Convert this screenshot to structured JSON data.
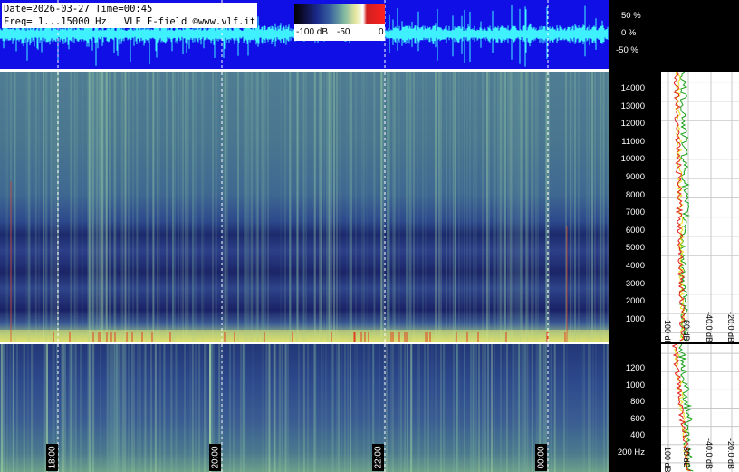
{
  "info": {
    "line1": "Date=2026-03-27 Time=00:45",
    "line2": "Freq= 1...15000 Hz   VLF E-field ©www.vlf.it"
  },
  "colorbar": {
    "labels": [
      "-100 dB",
      "-50",
      "0"
    ],
    "colors": [
      "#000000",
      "#1a2a8a",
      "#3a64a0",
      "#7fb8a0",
      "#e8e8a0",
      "#ffffff",
      "#ff2020"
    ]
  },
  "waveform_axis": [
    "50 %",
    "0 %",
    "-50 %"
  ],
  "freq_axis_high": [
    "14000",
    "13000",
    "12000",
    "11000",
    "10000",
    "9000",
    "8000",
    "7000",
    "6000",
    "5000",
    "4000",
    "3000",
    "2000",
    "1000"
  ],
  "freq_axis_low": [
    "1200",
    "1000",
    "800",
    "600",
    "400",
    "200 Hz"
  ],
  "time_labels": [
    "18:00",
    "20:00",
    "22:00",
    "00:00"
  ],
  "profile_db_labels": [
    "-100 dB",
    "-60 dB",
    "-40.0 dB",
    "-20.0 dB"
  ],
  "profile_db_labels_low": [
    "-100 dB",
    "-60 dB",
    "-40.0 dB",
    "-20.0 dB"
  ],
  "colors": {
    "waveform_bg": "#1010e6",
    "waveform_trace": "#3ff0ff",
    "profile_green": "#1aa01a",
    "profile_yellow": "#e8e020",
    "profile_red": "#e02020"
  }
}
